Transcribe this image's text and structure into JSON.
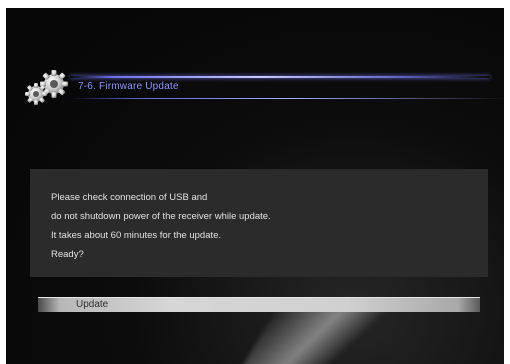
{
  "header": {
    "title": "7-6. Firmware Update",
    "icon": "gears-icon"
  },
  "message": {
    "lines": [
      "Please check connection of USB and",
      "do not shutdown power of the receiver while update.",
      "It takes about 60 minutes for the update.",
      "Ready?"
    ]
  },
  "actions": {
    "update_label": "Update"
  },
  "colors": {
    "title_text": "#8f96ff",
    "accent_line": "#6a6fe8",
    "panel": "#2b2b2b",
    "background": "#0c0c0c"
  }
}
